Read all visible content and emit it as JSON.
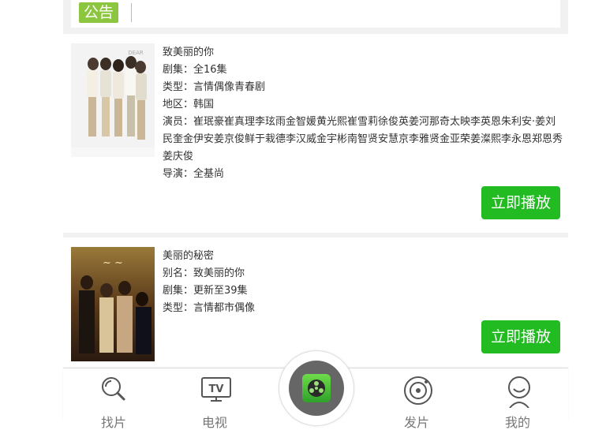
{
  "notice": {
    "badge": "公告"
  },
  "shows": [
    {
      "title": "致美丽的你",
      "episodes": "剧集：全16集",
      "genre": "类型：言情偶像青春剧",
      "region": "地区：韩国",
      "cast": "演员：崔珉豪崔真理李玹雨金智媛黄光熙崔雪莉徐俊英姜河那奇太映李英恩朱利安·姜刘民奎金伊安姜京俊鲜于栽德李汉威金宇彬南智贤安慧京李雅贤金亚荣姜澯熙李永恩郑恩秀姜庆俊",
      "director": "导演：全基尚",
      "play_label": "立即播放"
    },
    {
      "title": "美丽的秘密",
      "alias": "别名：致美丽的你",
      "episodes": "剧集：更新至39集",
      "genre": "类型：言情都市偶像",
      "play_label": "立即播放"
    }
  ],
  "bottom_nav": [
    {
      "label": "找片",
      "icon": "search-icon"
    },
    {
      "label": "电视",
      "icon": "tv-icon"
    },
    {
      "label": "",
      "icon": "film-reel-icon"
    },
    {
      "label": "发片",
      "icon": "disc-icon"
    },
    {
      "label": "我的",
      "icon": "user-icon"
    }
  ],
  "colors": {
    "badge": "#8cc63f",
    "play_button": "#22bb22",
    "background": "#f1f1f1"
  }
}
